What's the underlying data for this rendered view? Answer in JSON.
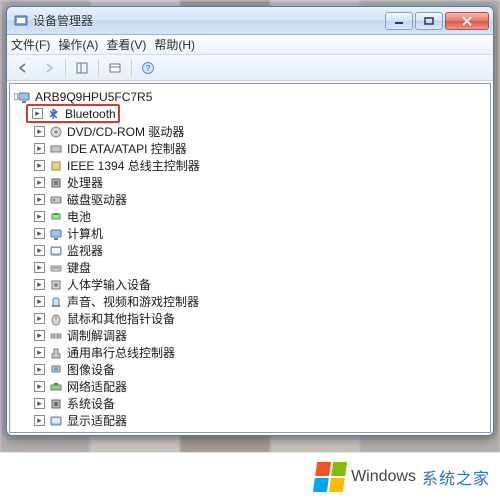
{
  "window": {
    "title": "设备管理器"
  },
  "menubar": {
    "file": "文件(F)",
    "action": "操作(A)",
    "view": "查看(V)",
    "help": "帮助(H)"
  },
  "tree": {
    "root": "ARB9Q9HPU5FC7R5",
    "items": [
      {
        "label": "Bluetooth",
        "highlight": true
      },
      {
        "label": "DVD/CD-ROM 驱动器"
      },
      {
        "label": "IDE ATA/ATAPI 控制器"
      },
      {
        "label": "IEEE 1394 总线主控制器"
      },
      {
        "label": "处理器"
      },
      {
        "label": "磁盘驱动器"
      },
      {
        "label": "电池"
      },
      {
        "label": "计算机"
      },
      {
        "label": "监视器"
      },
      {
        "label": "键盘"
      },
      {
        "label": "人体学输入设备"
      },
      {
        "label": "声音、视频和游戏控制器"
      },
      {
        "label": "鼠标和其他指针设备"
      },
      {
        "label": "调制解调器"
      },
      {
        "label": "通用串行总线控制器"
      },
      {
        "label": "图像设备"
      },
      {
        "label": "网络适配器"
      },
      {
        "label": "系统设备"
      },
      {
        "label": "显示适配器"
      }
    ]
  },
  "footer": {
    "brand1": "Windows",
    "brand2": "系统之家"
  }
}
